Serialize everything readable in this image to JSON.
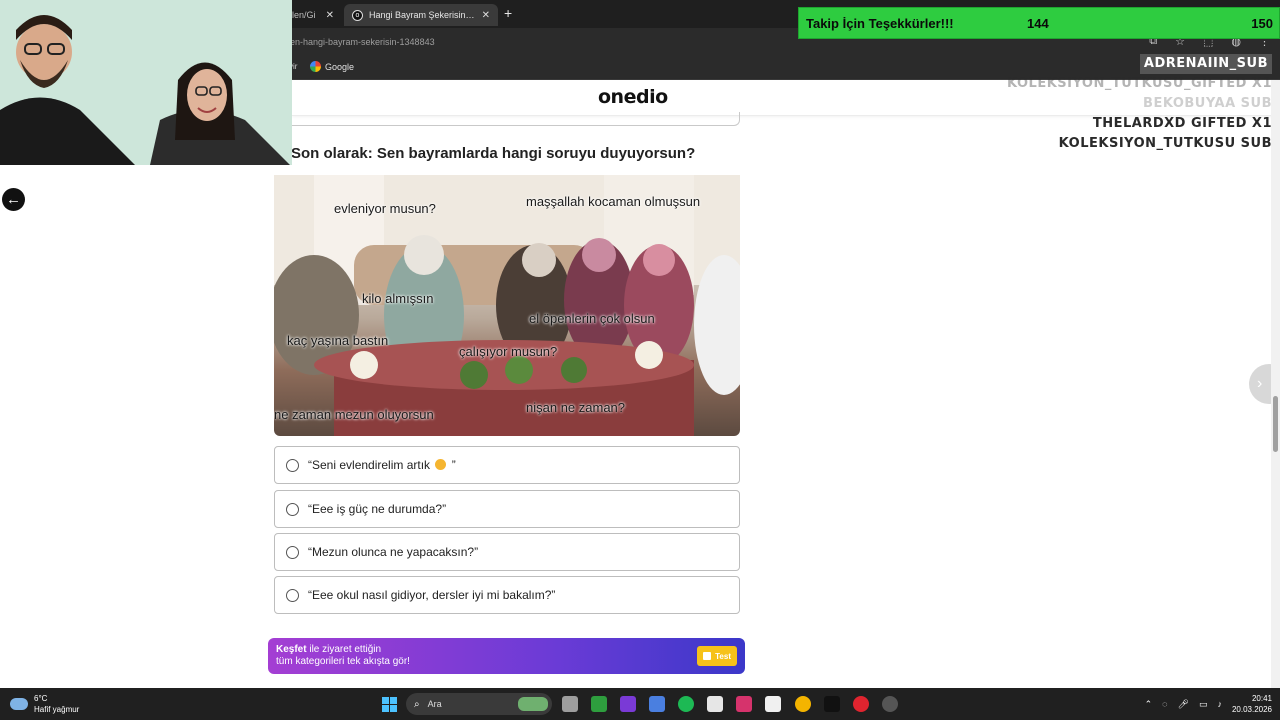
{
  "browser": {
    "tabs": [
      {
        "title": "len/Gi",
        "active": false
      },
      {
        "title": "Hangi Bayram Şekerisin? - One",
        "active": true
      }
    ],
    "url": "en-hangi-bayram-sekerisin-1348843",
    "bookmarks": [
      {
        "label": "Google"
      }
    ],
    "bookmark_cut_label": "vir"
  },
  "site": {
    "logo": "onedio",
    "question": "Son olarak: Sen bayramlarda hangi soruyu duyuyorsun?",
    "image_captions": [
      "evleniyor musun?",
      "maşşallah kocaman olmuşsun",
      "kilo almışsın",
      "el öpenlerin çok olsun",
      "kaç yaşına bastın",
      "çalışıyor musun?",
      "ne zaman mezun oluyorsun",
      "nişan ne zaman?"
    ],
    "options": [
      {
        "prefix": "“Seni evlendirelim artık",
        "suffix": "”",
        "has_emoji": true
      },
      {
        "prefix": "“Eee iş güç ne durumda?”",
        "suffix": "",
        "has_emoji": false
      },
      {
        "prefix": "“Mezun olunca ne yapacaksın?”",
        "suffix": "",
        "has_emoji": false
      },
      {
        "prefix": "“Eee okul nasıl gidiyor, dersler iyi mi bakalım?”",
        "suffix": "",
        "has_emoji": false
      }
    ],
    "kesfet": {
      "bold": "Keşfet",
      "line1_rest": " ile ziyaret ettiğin",
      "line2": "tüm kategorileri tek akışta gör!",
      "button": "Test"
    }
  },
  "overlay": {
    "follow_banner": "Takip İçin Teşekkürler!!!",
    "count_current": "144",
    "count_goal": "150",
    "subs": [
      "ADRENAIIN_SUB",
      "KOLEKSIYON_TUTKUSU_GIFTED X1",
      "BEKOBUYAA SUB",
      "THELARDXD  GIFTED X1",
      "KOLEKSIYON_TUTKUSU  SUB"
    ]
  },
  "taskbar": {
    "weather_temp": "6°C",
    "weather_desc": "Hafif yağmur",
    "search_placeholder": "Ara",
    "time": "20:41",
    "date": "20.03.2026"
  },
  "colors": {
    "follow_banner": "#2ecc40",
    "kesfet_gradient_start": "#a43ed3",
    "kesfet_gradient_end": "#3b38c9",
    "test_button": "#f6c21a"
  }
}
